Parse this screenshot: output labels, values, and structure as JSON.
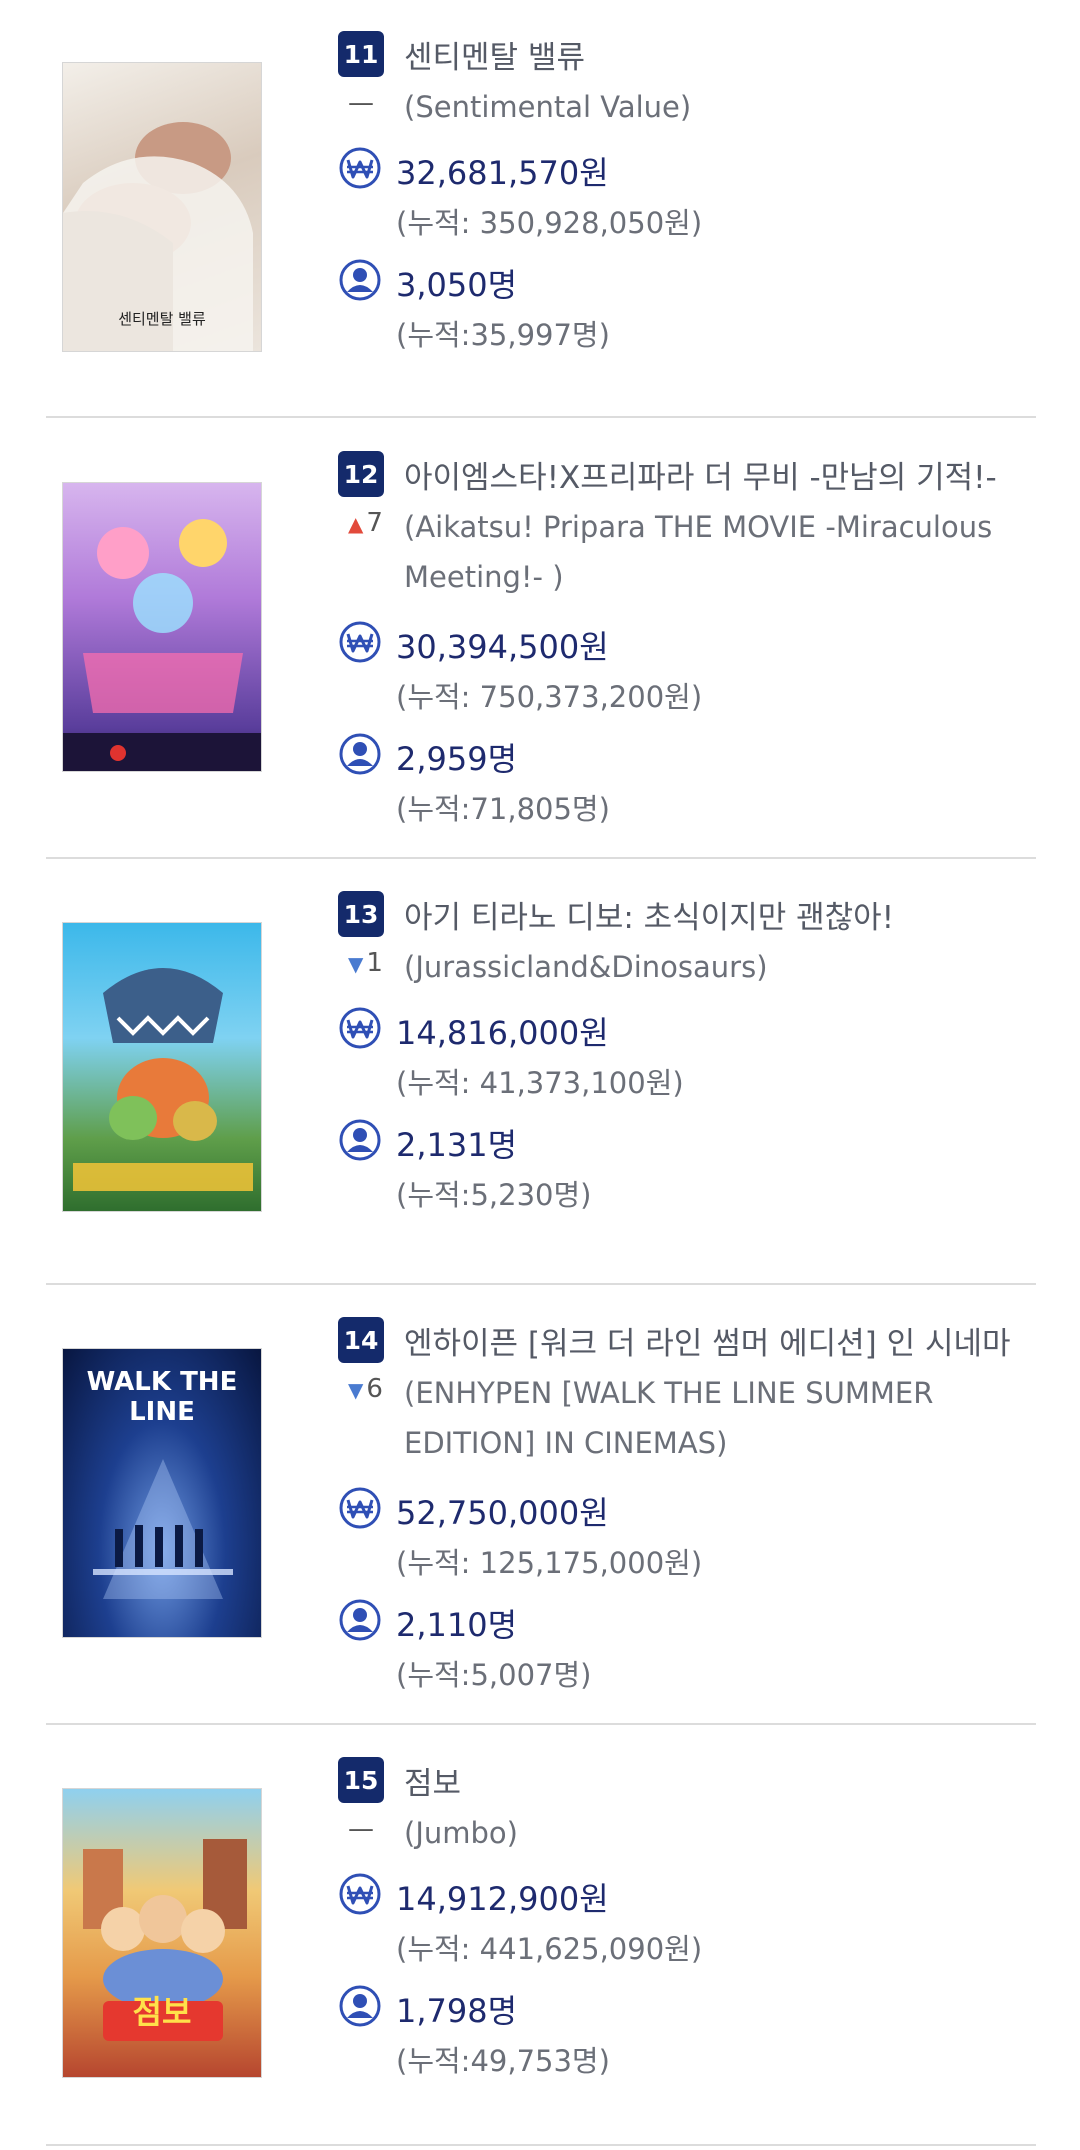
{
  "movies": [
    {
      "rank": "11",
      "change": "—",
      "change_dir": "none",
      "title_ko": "센티멘탈 밸류",
      "title_en": "(Sentimental Value)",
      "revenue": "32,681,570원",
      "revenue_total": "(누적: 350,928,050원)",
      "audience": "3,050명",
      "audience_total": "(누적:35,997명)",
      "poster_caption": "센티멘탈 밸류",
      "poster_colors": [
        "#f1ece6",
        "#c9b9a9"
      ]
    },
    {
      "rank": "12",
      "change": "7",
      "change_dir": "up",
      "title_ko": "아이엠스타!X프리파라 더 무비 -만남의 기적!-",
      "title_en": "(Aikatsu! Pripara THE MOVIE -Miraculous Meeting!- )",
      "revenue": "30,394,500원",
      "revenue_total": "(누적: 750,373,200원)",
      "audience": "2,959명",
      "audience_total": "(누적:71,805명)",
      "poster_caption": "",
      "poster_colors": [
        "#c79be0",
        "#6a3ea8"
      ]
    },
    {
      "rank": "13",
      "change": "1",
      "change_dir": "down",
      "title_ko": "아기 티라노 디보: 초식이지만 괜찮아!",
      "title_en": "(Jurassicland&Dinosaurs)",
      "revenue": "14,816,000원",
      "revenue_total": "(누적: 41,373,100원)",
      "audience": "2,131명",
      "audience_total": "(누적:5,230명)",
      "poster_caption": "",
      "poster_colors": [
        "#39b4e6",
        "#2f7a3a"
      ]
    },
    {
      "rank": "14",
      "change": "6",
      "change_dir": "down",
      "title_ko": "엔하이픈 [워크 더 라인 썸머 에디션] 인 시네마",
      "title_en": "(ENHYPEN [WALK THE LINE SUMMER EDITION] IN CINEMAS)",
      "revenue": "52,750,000원",
      "revenue_total": "(누적: 125,175,000원)",
      "audience": "2,110명",
      "audience_total": "(누적:5,007명)",
      "poster_caption": "WALK THE LINE",
      "poster_colors": [
        "#1b3d8c",
        "#061236"
      ]
    },
    {
      "rank": "15",
      "change": "—",
      "change_dir": "none",
      "title_ko": "점보",
      "title_en": "(Jumbo)",
      "revenue": "14,912,900원",
      "revenue_total": "(누적: 441,625,090원)",
      "audience": "1,798명",
      "audience_total": "(누적:49,753명)",
      "poster_caption": "점보",
      "poster_colors": [
        "#f2b94a",
        "#c4402e"
      ]
    }
  ]
}
